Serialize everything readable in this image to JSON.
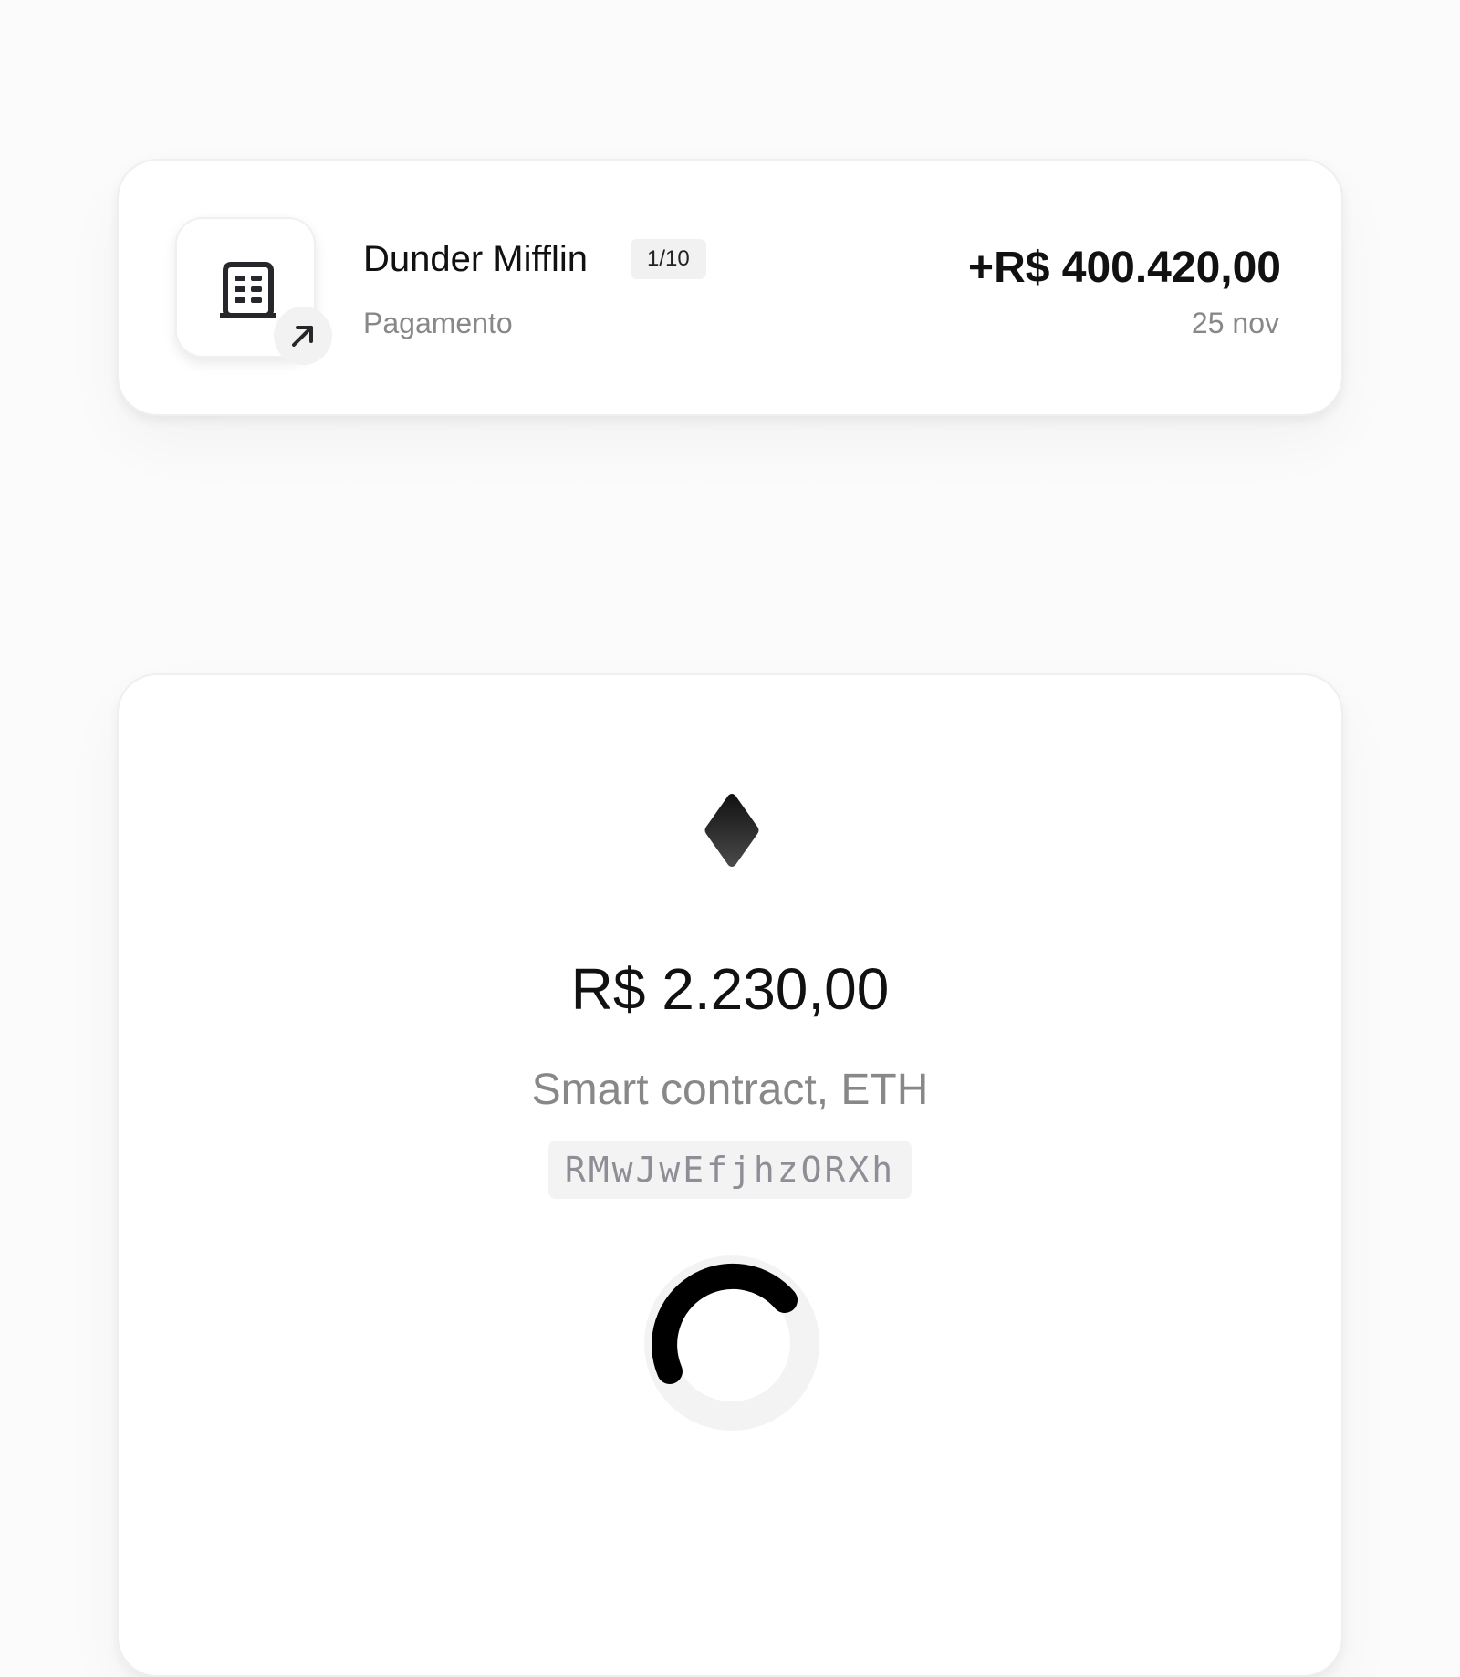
{
  "transaction": {
    "icon": "building-icon",
    "direction_icon": "arrow-up-right-icon",
    "name": "Dunder Mifflin",
    "count_badge": "1/10",
    "type": "Pagamento",
    "amount": "+R$ 400.420,00",
    "date": "25 nov"
  },
  "contract": {
    "icon": "ethereum-icon",
    "amount": "R$ 2.230,00",
    "description": "Smart contract, ETH",
    "hash": "RMwJwEfjhzORXh",
    "status": "loading-spinner",
    "spinner_color": "#000000",
    "spinner_track_color": "#f3f3f3"
  }
}
